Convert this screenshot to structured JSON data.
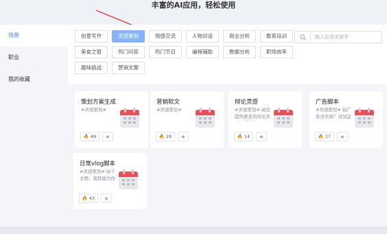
{
  "header": {
    "title": "丰富的AI应用，轻松使用"
  },
  "sidebar": {
    "items": [
      {
        "label": "场景",
        "active": true
      },
      {
        "label": "职业",
        "active": false
      },
      {
        "label": "我的收藏",
        "active": false
      }
    ]
  },
  "categories": {
    "row1": [
      "创意写作",
      "灵感策划",
      "情感交流",
      "人物对话",
      "商业分析",
      "教育培训"
    ],
    "row2": [
      "美食之窗",
      "热门问答",
      "热门节日",
      "编程辅助",
      "数据分析",
      "职场效率"
    ],
    "row3": [
      "趣味挑战",
      "营销文案"
    ],
    "active": "灵感策划"
  },
  "search": {
    "placeholder": "输入应用关键字"
  },
  "cards": [
    {
      "title": "策划方案生成",
      "desc": "#灵感策划#",
      "likes": "49"
    },
    {
      "title": "营销软文",
      "desc": "#灵感策划#",
      "likes": "29"
    },
    {
      "title": "辩论灵感",
      "desc": "#灵感策划# 给您提供更多的辩论灵感，提供您",
      "likes": "14"
    },
    {
      "title": "广告脚本",
      "desc": "#灵感策划# 拍广告没灵感？试试这个，专业技",
      "likes": "17"
    },
    {
      "title": "日常vlog脚本",
      "desc": "#灵感策划# 给个主题，我就能为你生成vlog",
      "likes": "43"
    }
  ],
  "colors": {
    "accent": "#3d7eff",
    "active_tag": "#84b4f9",
    "calendar_red": "#e8515a",
    "arrow": "#e53935"
  },
  "icons": {
    "fire": "fire-icon",
    "star": "star-icon",
    "calendar": "calendar-icon",
    "search": "search-icon"
  }
}
